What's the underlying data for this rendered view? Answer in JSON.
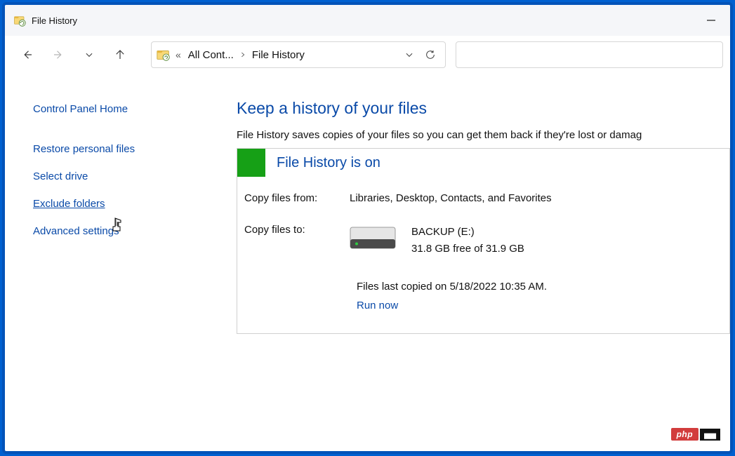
{
  "titlebar": {
    "title": "File History"
  },
  "breadcrumb": {
    "seg1": "All Cont...",
    "seg2": "File History"
  },
  "side": {
    "home": "Control Panel Home",
    "restore": "Restore personal files",
    "select": "Select drive",
    "exclude": "Exclude folders",
    "advanced": "Advanced settings"
  },
  "main": {
    "heading": "Keep a history of your files",
    "desc": "File History saves copies of your files so you can get them back if they're lost or damag",
    "status": "File History is on",
    "copy_from_label": "Copy files from:",
    "copy_from_value": "Libraries, Desktop, Contacts, and Favorites",
    "copy_to_label": "Copy files to:",
    "drive_name": "BACKUP (E:)",
    "drive_space": "31.8 GB free of 31.9 GB",
    "last_copied": "Files last copied on 5/18/2022 10:35 AM.",
    "run_now": "Run now"
  },
  "badge": {
    "php": "php",
    "cn": "▅▅"
  }
}
